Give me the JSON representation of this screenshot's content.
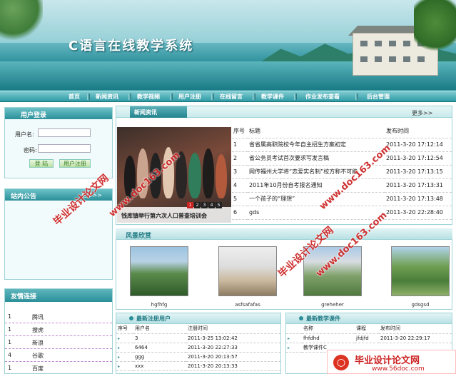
{
  "site": {
    "title": "C语言在线教学系统"
  },
  "nav": [
    "首页",
    "新闻资讯",
    "教学视频",
    "用户注册",
    "在线留言",
    "教学课件",
    "作业发布查看",
    "后台管理"
  ],
  "login": {
    "title": "用户登录",
    "username_label": "用户名:",
    "password_label": "密码:",
    "login_button": "登 陆",
    "register_button": "用户注册"
  },
  "notice": {
    "title": "站内公告",
    "more": "更多>>"
  },
  "links": {
    "title": "友情连接",
    "items": [
      "腾讯",
      "搜虎",
      "新浪",
      "谷歌",
      "百度"
    ]
  },
  "news": {
    "tab": "新闻资讯",
    "more": "更多>>",
    "photo_caption": "钱库镇举行第六次人口普查培训会",
    "pager": [
      "1",
      "2",
      "3",
      "4",
      "5"
    ],
    "active_page": "1",
    "columns": [
      "序号",
      "标题",
      "发布时间"
    ],
    "rows": [
      [
        "1",
        "省省属高职院校今年自主招生方案初定",
        "2011-3-20 17:12:14"
      ],
      [
        "2",
        "省公务员考试首次要求写发言稿",
        "2011-3-20 17:12:54"
      ],
      [
        "3",
        "网传福州大学将“恋爱实名制”校方称不可能",
        "2011-3-20 17:13:15"
      ],
      [
        "4",
        "2011年10月份自考报名通知",
        "2011-3-20 17:13:31"
      ],
      [
        "5",
        "一个孩子的“理想”",
        "2011-3-20 17:13:48"
      ],
      [
        "6",
        "gds",
        "2011-3-20 22:28:40"
      ]
    ]
  },
  "scenery": {
    "title": "风景欣赏",
    "captions": [
      "hgfhfg",
      "asfsafafas",
      "greheher",
      "gdsgsd"
    ]
  },
  "new_users": {
    "title": "最新注册用户",
    "columns": [
      "序号",
      "用户名",
      "注册时间"
    ],
    "rows": [
      [
        "3",
        "2011-3-25 13:02:42"
      ],
      [
        "6464",
        "2011-3-20 22:27:33"
      ],
      [
        "ggg",
        "2011-3-20 20:13:57"
      ],
      [
        "xxx",
        "2011-3-20 20:13:33"
      ]
    ]
  },
  "courses": {
    "title": "最新教学课件",
    "columns": [
      "名称",
      "课程",
      "发布时间"
    ],
    "rows": [
      [
        "fhfdhd",
        "jfdjfd",
        "2011-3-20 22:29:17"
      ],
      [
        "教学课件C",
        "",
        ""
      ]
    ]
  },
  "watermarks": {
    "doc_cn": "毕业设计论文网",
    "doc_url": "www.doc163.com",
    "corner_cn": "毕业设计论文网",
    "corner_url": "www.56doc.com"
  },
  "colors": {
    "accent": "#2a8f99",
    "nav_bg": "#4fb3bb",
    "watermark": "#cc2222"
  }
}
